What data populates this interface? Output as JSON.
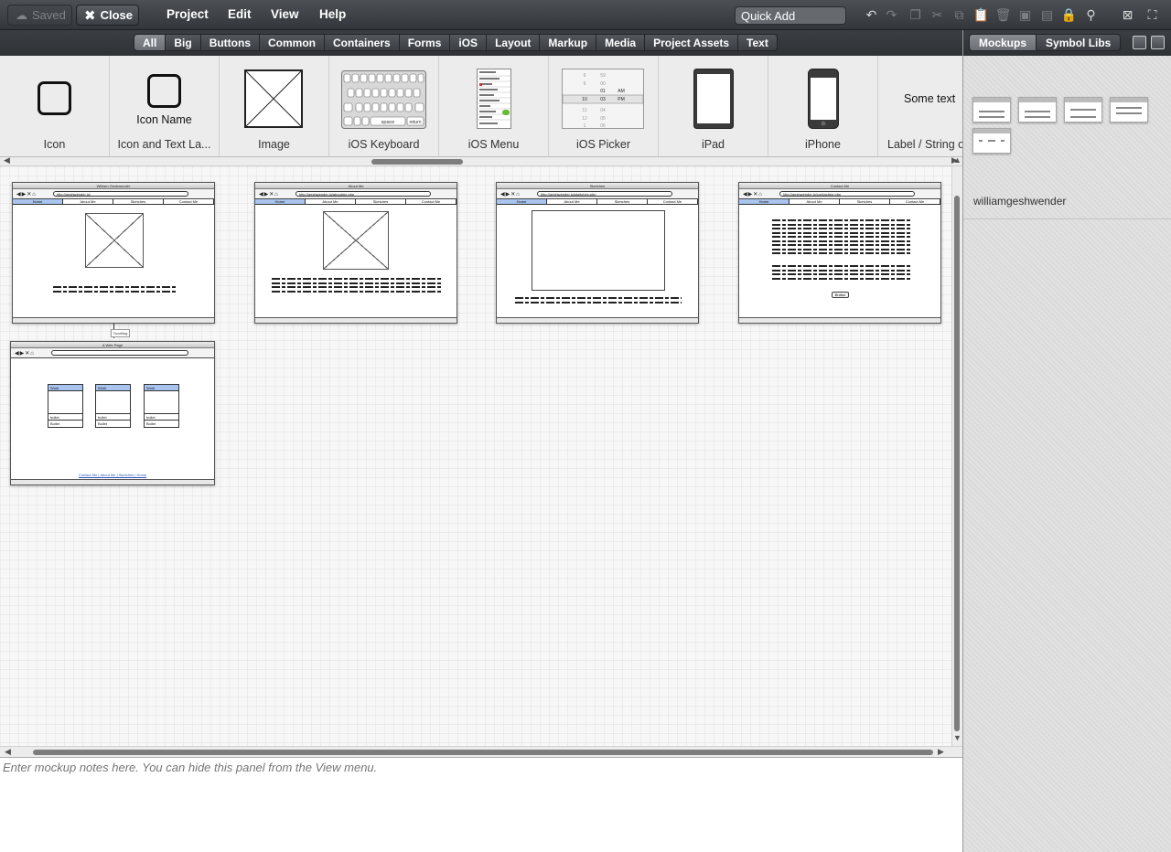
{
  "toolbar": {
    "saved_label": "Saved",
    "close_label": "Close",
    "menu": [
      "Project",
      "Edit",
      "View",
      "Help"
    ],
    "quick_add_placeholder": "Quick Add"
  },
  "filters": [
    "All",
    "Big",
    "Buttons",
    "Common",
    "Containers",
    "Forms",
    "iOS",
    "Layout",
    "Markup",
    "Media",
    "Project Assets",
    "Text"
  ],
  "active_filter": "All",
  "library": {
    "items": [
      "Icon",
      "Icon and Text La...",
      "Image",
      "iOS Keyboard",
      "iOS Menu",
      "iOS Picker",
      "iPad",
      "iPhone",
      "Label / String o"
    ],
    "icon_text_sample": "Icon Name",
    "label_sample": "Some text",
    "keyboard_space": "space",
    "keyboard_return": "return",
    "picker": [
      [
        "",
        "",
        "AM"
      ],
      [
        "10",
        "03",
        "PM"
      ]
    ]
  },
  "right_panel": {
    "tabs": [
      "Mockups",
      "Symbol Libs"
    ],
    "project_name": "williamgeshwender"
  },
  "mockups": [
    {
      "title": "William Geshwender",
      "url": "http://geshwender.io/",
      "tabs": [
        "Home",
        "About Me",
        "Sketches",
        "Contact Me"
      ],
      "selected_tab": 0
    },
    {
      "title": "About Me",
      "url": "http://geshwender.io/aboutme.php",
      "tabs": [
        "Home",
        "About Me",
        "Sketches",
        "Contact Me"
      ],
      "selected_tab": 0
    },
    {
      "title": "Sketches",
      "url": "http://geshwender.io/sketches.php",
      "tabs": [
        "Home",
        "About Me",
        "Sketches",
        "Contact Me"
      ],
      "selected_tab": 0
    },
    {
      "title": "Contact Me",
      "url": "http://geshwender.io/contactme.php",
      "tabs": [
        "Home",
        "About Me",
        "Sketches",
        "Contact Me"
      ],
      "selected_tab": 0,
      "button": "Button"
    },
    {
      "title": "A Web Page",
      "url": "",
      "columns": [
        {
          "header": "Work",
          "rows": [
            "bullet",
            "Bullet"
          ]
        },
        {
          "header": "Work",
          "rows": [
            "bullet",
            "Bullet"
          ]
        },
        {
          "header": "Work",
          "rows": [
            "bullet",
            "Bullet"
          ]
        }
      ],
      "footer": "Contact Me | About Me | Sketches | Home"
    }
  ],
  "link_badge": "Scrolling",
  "notes_placeholder": "Enter mockup notes here. You can hide this panel from the View menu."
}
